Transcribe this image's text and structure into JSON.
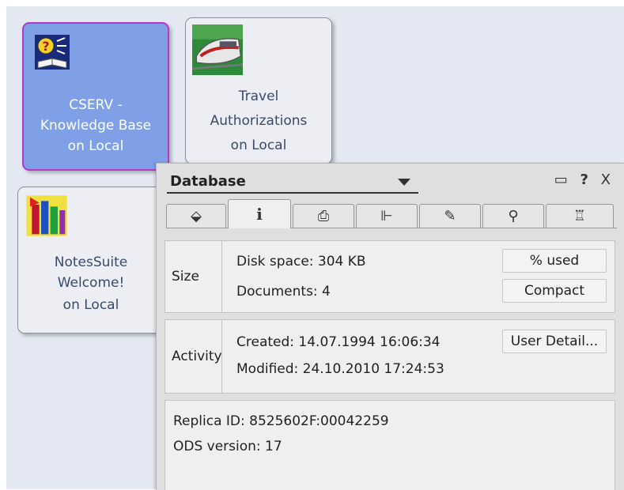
{
  "workspace": {
    "tiles": [
      {
        "lines": [
          "CSERV -",
          "Knowledge Base",
          "on Local"
        ],
        "icon": "help-book-icon",
        "selected": true
      },
      {
        "lines": [
          "Travel",
          "Authorizations",
          "on Local"
        ],
        "icon": "train-icon",
        "selected": false
      },
      {
        "lines": [
          "NotesSuite",
          "Welcome!",
          "on Local"
        ],
        "icon": "notessuite-icon",
        "selected": false
      }
    ]
  },
  "panel": {
    "title": "Database",
    "tools": {
      "minimize": "▭",
      "help": "?",
      "close": "X"
    },
    "tabs": [
      "basics-tab-icon",
      "info-tab-icon",
      "print-tab-icon",
      "design-tab-icon",
      "launch-tab-icon",
      "search-tab-icon",
      "advanced-tab-icon"
    ],
    "tab_glyphs": [
      "⬙",
      "i",
      "⎙",
      "⊩",
      "✎",
      "⚲",
      "♖"
    ],
    "size": {
      "label": "Size",
      "disk_space": "Disk space:  304 KB",
      "documents": "Documents:  4",
      "used_button": "% used",
      "compact_button": "Compact"
    },
    "activity": {
      "label": "Activity",
      "created": "Created:  14.07.1994 16:06:34",
      "modified": "Modified: 24.10.2010 17:24:53",
      "user_detail_button": "User Detail..."
    },
    "info": {
      "replica_id": "Replica ID:    8525602F:00042259",
      "ods_version": "ODS version: 17"
    }
  }
}
